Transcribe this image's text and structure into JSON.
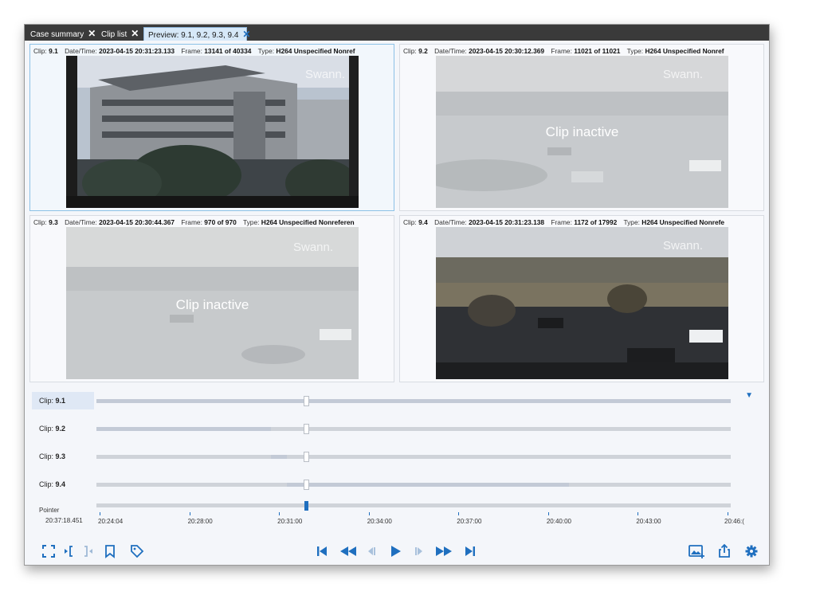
{
  "tabs": [
    {
      "label": "Case summary"
    },
    {
      "label": "Clip list"
    },
    {
      "label": "Preview: 9.1, 9.2, 9.3, 9.4"
    }
  ],
  "meta_labels": {
    "clip": "Clip:",
    "datetime": "Date/Time:",
    "frame": "Frame:",
    "of": "of",
    "type": "Type:"
  },
  "panels": [
    {
      "clip": "9.1",
      "datetime": "2023-04-15 20:31:23.133",
      "frame": "13141",
      "total": "40334",
      "type": "H264 Unspecified Nonref",
      "status": "",
      "watermark": "Swann."
    },
    {
      "clip": "9.2",
      "datetime": "2023-04-15 20:30:12.369",
      "frame": "11021",
      "total": "11021",
      "type": "H264 Unspecified Nonref",
      "status": "Clip inactive",
      "watermark": "Swann."
    },
    {
      "clip": "9.3",
      "datetime": "2023-04-15 20:30:44.367",
      "frame": "970",
      "total": "970",
      "type": "H264 Unspecified Nonreferen",
      "status": "Clip inactive",
      "watermark": "Swann."
    },
    {
      "clip": "9.4",
      "datetime": "2023-04-15 20:31:23.138",
      "frame": "1172",
      "total": "17992",
      "type": "H264 Unspecified Nonrefe",
      "status": "",
      "watermark": "Swann."
    }
  ],
  "timeline": {
    "rows": [
      {
        "label": "Clip:",
        "clip": "9.1",
        "range_start": 0.0,
        "range_end": 1.0,
        "position": 0.33
      },
      {
        "label": "Clip:",
        "clip": "9.2",
        "range_start": 0.0,
        "range_end": 0.275,
        "position": 0.33
      },
      {
        "label": "Clip:",
        "clip": "9.3",
        "range_start": 0.275,
        "range_end": 0.3,
        "position": 0.33
      },
      {
        "label": "Clip:",
        "clip": "9.4",
        "range_start": 0.3,
        "range_end": 0.745,
        "position": 0.33
      }
    ],
    "pointer_label": "Pointer",
    "pointer_time": "20:37:18.451",
    "pointer_position": 0.33,
    "ticks": [
      "20:24:04",
      "20:28:00",
      "20:31:00",
      "20:34:00",
      "20:37:00",
      "20:40:00",
      "20:43:00",
      "20:46:("
    ],
    "accent_color": "#1f6fbf"
  },
  "toolbar": {
    "left": [
      "fullscreen-icon",
      "mark-in-icon",
      "mark-out-icon",
      "bookmark-icon",
      "tag-icon"
    ],
    "center": [
      "skip-to-start-icon",
      "rewind-icon",
      "step-back-icon",
      "play-icon",
      "step-forward-icon",
      "fast-forward-icon",
      "skip-to-end-icon"
    ],
    "right": [
      "snapshot-icon",
      "export-icon",
      "settings-icon"
    ]
  }
}
